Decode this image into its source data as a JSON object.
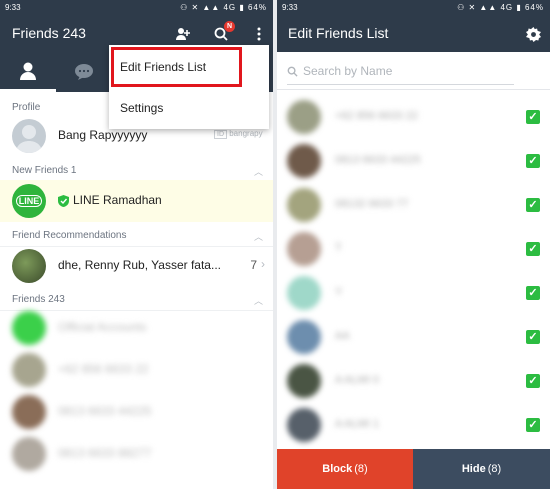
{
  "left": {
    "status": {
      "time": "9:33",
      "icons": "⚇ ✕ ▲▲ 4G ▮ 64%"
    },
    "header": {
      "title": "Friends 243",
      "badge": "N"
    },
    "tabs": [
      "friends",
      "chats"
    ],
    "menu": {
      "items": [
        "Edit Friends List",
        "Settings"
      ]
    },
    "sections": {
      "profile": "Profile",
      "new_friends": "New Friends 1",
      "recommendations": "Friend Recommendations",
      "friends": "Friends 243"
    },
    "profile": {
      "name": "Bang Rapyyyyyy",
      "id": "bangrapy"
    },
    "new_friend": {
      "name": "LINE Ramadhan",
      "logo": "LINE"
    },
    "recommendation": {
      "names": "dhe, Renny Rub, Yasser fata...",
      "count": "7"
    },
    "friends": [
      "Official Accounts",
      "+62 856 6633 22",
      "0813 6633 44225",
      "0813 6633 88277"
    ]
  },
  "right": {
    "status": {
      "time": "9:33",
      "icons": "⚇ ✕ ▲▲ 4G ▮ 64%"
    },
    "header": {
      "title": "Edit Friends List"
    },
    "search": {
      "placeholder": "Search by Name"
    },
    "friends": [
      "+62 856 6633 22",
      "0813 6633 44225",
      "08132 6633 77",
      "T",
      "Y",
      "AA",
      "A ALMI 0",
      "A ALMI 1"
    ],
    "buttons": {
      "block": "Block",
      "block_count": "(8)",
      "hide": "Hide",
      "hide_count": "(8)"
    },
    "colors": {
      "block": "#e0432a",
      "hide": "#3c4c60",
      "check": "#2cbc41"
    }
  },
  "colors": {
    "header": "#2e3b4a",
    "highlight": "#e1161d",
    "new_friend_bg": "#fefde6"
  }
}
